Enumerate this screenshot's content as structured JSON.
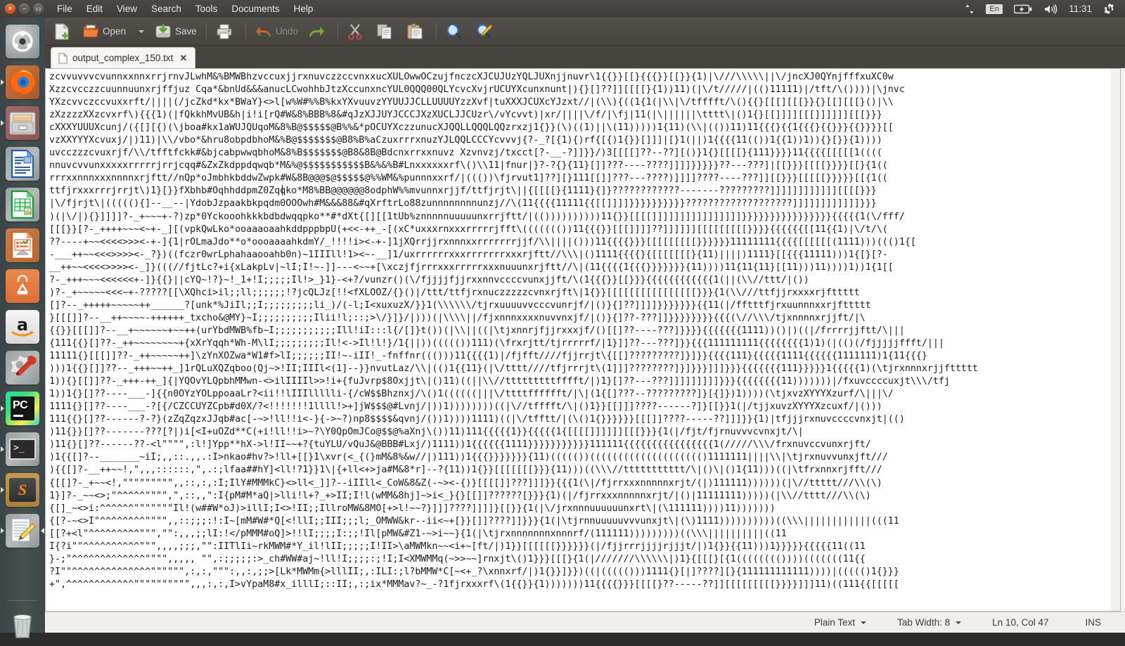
{
  "panel": {
    "window_buttons": [
      {
        "name": "close",
        "glyph": "✕"
      },
      {
        "name": "minimize",
        "glyph": "–"
      },
      {
        "name": "maximize",
        "glyph": "▭"
      }
    ],
    "menus": [
      "File",
      "Edit",
      "View",
      "Search",
      "Tools",
      "Documents",
      "Help"
    ],
    "indicators": {
      "network_icon": "↑↓",
      "keyboard_layout": "En",
      "battery_icon": "battery-icon",
      "volume_icon": "🔊",
      "clock": "11:31",
      "session_icon": "gear-power-icon"
    }
  },
  "launcher": {
    "items": [
      {
        "name": "ubuntu-dash",
        "label": "Dash home",
        "running": false
      },
      {
        "name": "firefox",
        "label": "Firefox Web Browser",
        "running": true
      },
      {
        "name": "files",
        "label": "Files",
        "running": true
      },
      {
        "name": "libreoffice-writer",
        "label": "LibreOffice Writer",
        "running": false
      },
      {
        "name": "libreoffice-calc",
        "label": "LibreOffice Calc",
        "running": false
      },
      {
        "name": "libreoffice-impress",
        "label": "LibreOffice Impress",
        "running": false
      },
      {
        "name": "ubuntu-software",
        "label": "Ubuntu Software Center",
        "running": false
      },
      {
        "name": "amazon",
        "label": "Amazon",
        "running": false
      },
      {
        "name": "system-settings",
        "label": "System Settings",
        "running": false
      },
      {
        "name": "pycharm",
        "label": "PyCharm",
        "running": true
      },
      {
        "name": "terminal",
        "label": "Terminal",
        "running": true
      },
      {
        "name": "sublime-text",
        "label": "Sublime Text",
        "running": true
      },
      {
        "name": "text-editor",
        "label": "Text Editor",
        "running": true,
        "focused": true
      },
      {
        "name": "trash",
        "label": "Trash",
        "running": false
      }
    ]
  },
  "toolbar": {
    "new_label": "",
    "open_label": "Open",
    "save_label": "Save",
    "print_label": "",
    "undo_label": "Undo",
    "redo_label": "",
    "cut_label": "",
    "copy_label": "",
    "paste_label": "",
    "find_label": "",
    "replace_label": ""
  },
  "tabs": [
    {
      "title": "output_complex_150.txt",
      "close": "✕",
      "active": true
    }
  ],
  "statusbar": {
    "language": "Plain Text",
    "tab_width": "Tab Width: 8",
    "cursor_position": "Ln 10, Col 47",
    "insert_mode": "INS"
  },
  "document": {
    "filename": "output_complex_150.txt",
    "cursor_line": 10,
    "cursor_column": 47,
    "lines": [
      "zcvvuvvvcvunnxxnnxrrjrnvJLwhM&%BMWBhzvccuxjjrxnuvczzccvnxxucXULOwwOCzujfnczcXJCUJUzYQLJUXnjjnuvr\\1{{}}[[}{{{}}[[}}{1)|\\///\\\\\\\\\\||\\/jncXJ0QYnjfffxuXC0w",
      "Xzzcvcczzcuunnuunxrjffjuz Cqa*&bnUd&&&anucLCwohhbJtzXccunxncYUL0QQQ00QLYcvcXvjrUCUYXcunxnunt|){}[]??]][[[[}{1))11)(|\\/t/////|(()11111)|/tft/\\())))|\\jnvc",
      "YXzcvvczccvuxxrft/||||(/jcZkd*kx*BWaY}<>l[w%W#%%B%kxYXvuuvzYYUUJJCLLUUUUYzzXvf|tuXXXJCUXcYJzxt//|(\\\\){((1{1(|\\\\|\\/tfffft/\\(){{}[[[][[[}}{}[[][[[}()|\\\\",
      "zXzzzzXXzcvxrf\\){{{1)(|fQkkhMvUB&h|i!i[rQ#W&8%BBB%8&#qJzXJJUYJCCCJXzXUCLJJCUzr\\/vYcvvt)|xr/||||\\/f/|\\fj|11(|\\||||||\\tttt\\|()1{}[[]]]][[[]]]]]][[[}}}",
      "cXXXYUUUXcunj/({[][{)(\\jboa#kx1aWUJQUqoM&8%B@$$$$$@B%%&*pOCUYXczzunucXJQQLLQQQLQQzrxzj1{}}(\\)((1)||\\(11)))))1{11)(\\\\|(())11)11{{{}{{1{{{}{{}}}{{}}}}[[",
      "vzXXYYYXcvuxj/|)11)|\\\\/vbo*&hru8obpdbhoM&%B@$$$$$$$@B8%B%aCzuxrrrxnuzYJLQQLCCCYcvvvj{?-_?[{1){)rf{[{)1{}}[]]]|[}1(||)1{{{{11(())1{{1))1)){}[}}{1))))",
      "uvcczzzcvuxrjf/\\\\/tfftfckk#&bjcabpwwqbhoM&8%B$$$$$$$@B8&8B@Bdcnxrrxxnuvz Xzvnvzj/txcct[?-__-?]]}}/)3[[[[]??--??][()}1{}[[[[}{111}}}}11{{{{[[[[[1((((",
      "nnuvcvvunxxxxxrrrrrjrrjcqq#&ZxZkdppdqwqb*M&%@$$$$$$$$$$$B&%&%B#Lnxxxxxxrf\\()\\\\11|fnur|}?-?{}{11}[]]???----????]]]]}}}}}??---???]|[[}}}[[[[}}}}[[}{1((",
      "rrrxxnnnxxxnnnnxrjftt//nQp*oJmbhkbddwZwpk#W&8B@@@$@$$$$$@%%WM&%punnnxxrf/|((())\\fjrvut1]??][}111[[]]???---????)]]]]????----???]][[}}}[[[[[}}}}}[[{1((",
      "ttfjrxxxrrrjrrjt\\)1}[}}fXbhb#OqhhddpmZ0Zqqko*M8%BB@@@@@@8odphW%%mvunnxrjjf/ttfjrjt\\||{[[[[}{1111}{]}????????????-------?????????]]]]]]]]]]]][[[[}}}",
      "|\\/fjrjt\\|(((((){]--__--|YdobJzpaakbkpqdm0OOOwh#M&&&88&#qXrftrLo88zunnnnnnnnunzj//\\(11{{{{11111{{[[]]]]}}}}}}}}}}???????????????????]]]]]]]]]]]]}}}",
      ")(|\\/|){}]]]]?-_+~~~+-?)zp*0Yckooohkkkbdbdwqqpko**#*dXt{[][[1tUb%znnnnnuuuuunxrrjftt/|(())))))))))11{}}[[[[]]]]]]]]]]]]]]]]}}}}}}}}}}}}}}}}{{{{{1(\\/fff/",
      "[[[}}[?-_++++~~~<~+-_][(vpkQwLko*ooaaaoaahkddpppbpU(+<<-++_-[(xC*uxxxrnxxxrrrrrjfft\\((((((())11{{{}}[[[]]]]??]]]]]][[[[[[[[[}}}}{{{{{{[[11{{1)|\\/t/\\(",
      "??----+~~<<<<>>><-+-]{1|rOLmaJdo**o*oooaaaahkdmY/_!!!!i><-+-]1jXQrrjjrxnnnxxrrrrrrrjjf/\\\\||||()))11{{{{}}}[[[[[[[[[}}}}}}11111111{{{{[[[[[[(1111)))((()1{[",
      "-___++~~<<<>>>><-_?})((fczr0wrLphahaaooahb0n)~1IIIll!1><~-__]1/uxrrrrrrxxxrrrrrrrxxxrjftt//\\\\\\|()1111{{{{}{[[[[[[[}{11)||||)1111}[[{{{11111)))1{[}[?-",
      "__++~~<<<<>>>><-_]}(((//fjtLc?+i{xLakpLv|~lI;I!~-]]---<~~+[\\xczjfjrrrxxxrrrrrxxxnuuunxrjftt//\\|(11{{{{1{{{}}}}}}}{11))))11{11{11}[[11)))11))))1))1{1[[",
      "?-_+++~~~<<<<<<+-]}{{}||cYQ~!?}~!_1+!I;;;;;Il!>_}1}-<+?/vunzr()(\\/fjjjjfjjrxxnnvccccvunxjjft/\\(1{{{}}[[}}}{{{{{{{{{{{{1(||(\\\\//ttt/|())",
      ")?-_+~~~~~<<<~+-?????[[\\XQhci>il;;ll;;;;;;!?jcQLJz[!!<fXLOOZ/{}()|/ttt/ttfjrxnuczzzzzcvnxrjft\\|1{}}[[[[[[[[[[[[[[[[}}}{1(\\\\///ttfjjrxxxxrjfttttt",
      "[]?--_+++++~~~~~++______?[unk*%JiIl;;I;;;;;;;;;li_)/(-l;I<xuxuzX/}}1(\\\\\\\\\\\\/tjrxuuuuvvcccvunrjf/|()}{]??]]]]}}}}}}}{{11(|/fftttfjrxuunnnxxrjfttttt",
      "}[[[]]?--__++~~~~-++++++_txcho&@MY}~I;;;;;;;;;;Ilii!l;::;>\\/}]}/|)))(|\\\\\\\\||/fjxnnnxxxxnuvvnxjf/|()}{]??-???]]}}}}}}}}{{{(\\//\\\\\\/tjxnnnnxrjjft/|\\",
      "{{}}[[[]]?--__+~~~~~~+~~++(urYbdMWB%fb~I;;;;;;;;;;;Ill!iI:::l{/[]}t())(|\\\\||((|\\tjxnnrjfjjrxxxjf/()[[]??----???]}}}}{{{{{{{1111))()|)((|/frrrrjjftt/\\|||",
      "{111{{}[]??-_++~~~~~~~~+{xXrYqqh*Wh-M\\lI;;;;;;;;;Il!<->Il!l!}/1{||))((((())111)(\\frxrjtt/tjrrrrrf/|1}]]??---???]}}{{{111111111{{{{{{{{1)1)(|(()(/fjjjjjffft/|||",
      "11111{}[[[]]??-_++~~~~~++]\\zYnXOZwa*W1#f>lI;;;;;;II!~-iII!_-fnffnr((()))11{{{{1)|/fjfft////fjjrrjt\\{[[]?????????]}]}}{{{{111}{{{{{1111{{{{{{1111111)1{11{{{}",
      ")))1{{}[]]??--_+++~~++_]1rQLuXQZqboo(Qj~>!II;IIIl<(1]--}}nvutLaz/\\\\|(()1{{11}(|\\/tttt////tfjrrrjt\\(1]]]????????]}]}}}]]]}}}{{{{{{{111}}}}}1{{{{{1)(\\tjrxnnnxrjjfttttt",
      "1)){}[[]]??-_+++-++_]{|YQOvYLQpbhMMwn-<>ilIIIIl>>!i+{fuJvrp$8Oxjjt\\|()11)((||\\\\//tttttttttfffft/|)1}[]??---???]]]]]]]]]}}}{{{{{{{{11)))))))|/fxuvccccuxjt\\\\\\/tfj",
      "1))1{}[]??----___-]{{n0OYzYOLppoaaLr?<ii!!lIIIllllli-{/cW$$Bhznxj/\\()1((((((|||\\/ttttfffffft/|\\|(1{[]???--?????????]}[{]})1))))(\\tjxvzXYYYXzurf/\\|||\\/",
      "1111{}[]??----___-?[{/CZCCUYZCpb#d0X/?<!!!!!!!1llll!>+]jW$$$@#Lvnj/|))1))))))))((|\\//tfffft/\\|()1}}[[]]]????------?]}[[}}1(|/tjjxuvzXYYYXzcuxf/|()))",
      "111{{}[]??------?-?}(zZqZqzxJJqb#ac[-~>!ll!!i<-}{->~?)np8$$$$&qvnj/())1))))1111)((|\\/tfftt/|(\\()1{}}}}}}[[[]]????-----??]]]}}{1)|tfjjjrxnuvccccvnxjt|(()",
      ")11{}}[]??-------???[?|)i[<I+uOZd**C(+i!ll!!i>~?\\Y0QpOmJCo@$$@%aXnj\\())11)111{{{{{1}}{{{{{1{[[[[]]]]]][[[}}}{1(|/fjt/fjrnuvvvcvnxjt/\\|",
      ")11{}[]??------??-<l\"\"\"\",:l!]Ypp**hX->l!II~~+?{tuYLU/vQuJ&@BBB#Lxj/)1111))1{{{{{{1111}}}}}}}}}}}111111{{{{{{{{{{{{{{{{1(/////\\\\\\/frxnuvccvunxrjft/",
      ")1{{[]?--_______~iI;,,::.,,.:I>nkao#hv?>!ll+[[}1\\xvr(<_{(}mM&8%&w//|)111))1{{{}}}}}}}{11)((((())(((((((((((((((((((()1111111||||\\\\|\\tjrxnuvvunxjft///",
      "){{[]?-__++~~!,\",,,::::::,\",.:;lfaa##hY]<ll!?1}}1\\|{+ll<+>ja#M&8*r]--?{11))1{}}[[[[[[[}}}{11)))((\\\\\\//ttttttttttt/\\|()\\|()1{11)))((|\\tfrxnnxrjfft///",
      "{[[]?-_+~~<!,\"\"\"\"\"\"\"\"\",,::,:,:I;IlY#MMMkC}<>ll<_]]?--iIIll<_CoW&8&Z(-~><-{)}[[[[]]???]]]}}{{{1(\\|/fjrrxxxnnnnnxrjt/(|)111111))))))(|\\//ttttt///\\\\(\\)",
      "1}]?-_~~<>;\"^^^^^\"\"\"\",\",::,,\":I{pM#M*aQ|>lli!l+?_+>II;I!l(wMM&8hj]~>i<_}{}[[]]??????[}}}{1)(|/fjrrxxxnnnnnxrjt/|()|11111111)))))(|\\\\//tttt///\\\\(\\)",
      "{[]_~<>i:^^^^^^\"\"\"\"\"\"\"Il!(w##W*oJ)>illI;I<>!II;;IllroMW&8MO[+>l!~~?}]]]????]]]]}[[}}{1(|\\/jrxnnnuuuuuunxrt\\|(\\111111))))11)))))))",
      "{[?-~<>I\"^^^^^^^^\"\"\"\",,::;;;:!:I~[mM#W#*Q[<!llI;;III;;;l;_OMWW&kr--ii<~+[}}[]]????]]}}}{1(|\\tjrnnuuuuuvvvunxjt\\|(\\)1111))))))))))((\\\\\\||||||||||||(((11",
      "[[?+<l\"^^^^^^^^^\"\"\",\"\":,,,;;lI:!</pMMM#oQ]>!!lI;;;;I:;;!Il[pMW&#Z1-~>i~~}{1(|\\tjrxnnnnnnnxnnnrf/(111111)))))))))((\\\\\\||||||||||((11",
      "I{?i\"\"^^^^^^^^^^\"\"\",,,,;;;,\"\":IITlIi~rkMWM#*Y_il!lII;;;;;I!II>\\aMWMkn~~<i+~[ft/|)1}}[[[[[[}}}}}}(|/fjjrrrjjjjrjjjt/|)1{}}{{11)))1}}}}}{{{{{11((11",
      "}-;\"^^^^^^^^^^^^^\"\"\"\",,,,, \"\",:;;;;;:>_ch#WW#aj~!ll!I;;;;:;!I;I<XMWMMq(~>>~~]rnxjt\\()1}}}[[[}{1(|///////\\\\\\\\\\\\|)1}{[[[}[{1(((((((())))(((((((11{{",
      "?I\"\"^^^^^^^^^^^^^^\"\"\"\"\"\",:,:,\"\"\":,,:,;;>[Lk*MWMm{>lllII;,:ILI:;l?bMMW*C[~<+_?\\xnnxrf/|)1{}}]}})((|((((()))1111{}[|]????][}{111111111111))))|((((()1{}}}",
      "+\",^^^^^^^^^^^^\"\"\"\"\"\"\"\"\"\",,,:,:,I>vYpaM8#x_illlI;::II;,:;ix*MMMav?~_-?1fjrxxxrf\\(1{{}}{1)))))))11{{{{}}}[[[[}??-----??]][[[[[[[[[}}}}]]]11)((111{{[[[[["
    ]
  }
}
